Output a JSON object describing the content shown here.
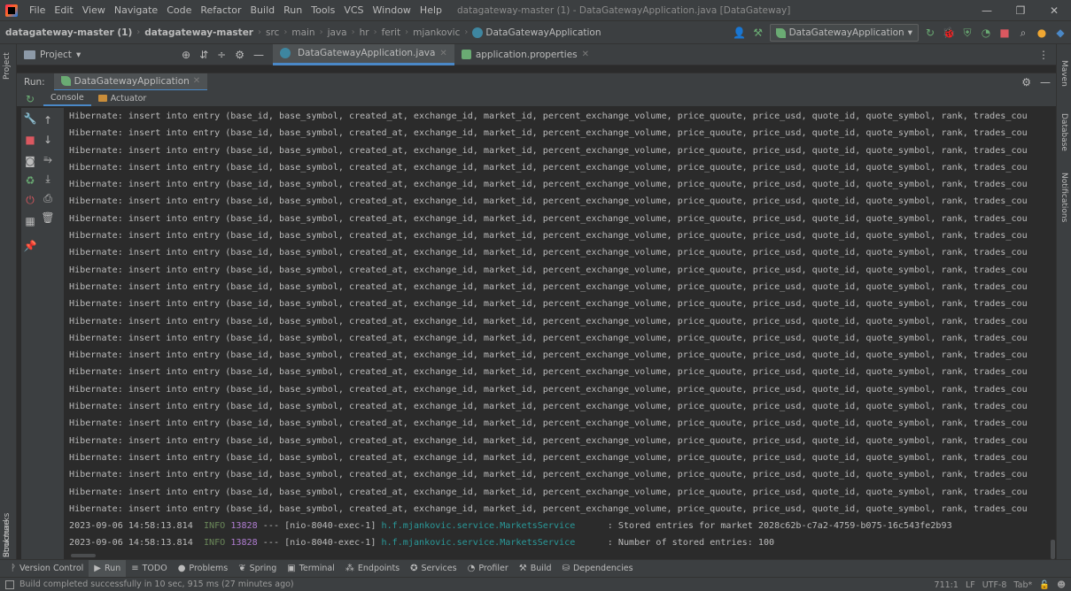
{
  "window": {
    "menu": [
      "File",
      "Edit",
      "View",
      "Navigate",
      "Code",
      "Refactor",
      "Build",
      "Run",
      "Tools",
      "VCS",
      "Window",
      "Help"
    ],
    "title": "datagateway-master (1) - DataGatewayApplication.java [DataGateway]",
    "controls": [
      "—",
      "❐",
      "✕"
    ]
  },
  "navbar": {
    "crumbs": [
      "datagateway-master (1)",
      "datagateway-master",
      "src",
      "main",
      "java",
      "hr",
      "ferit",
      "mjankovic",
      "DataGatewayApplication"
    ],
    "run_config": "DataGatewayApplication"
  },
  "project_bar": {
    "project_label": "Project",
    "tabs": [
      {
        "label": "DataGatewayApplication.java",
        "active": true
      },
      {
        "label": "application.properties",
        "active": false
      }
    ]
  },
  "left_stripe": [
    "Project",
    "Bookmarks",
    "Structure"
  ],
  "right_stripe": [
    "Maven",
    "Database",
    "Notifications"
  ],
  "run_window": {
    "label": "Run:",
    "tab": "DataGatewayApplication",
    "subtabs": [
      "Console",
      "Actuator"
    ]
  },
  "console": {
    "insert_line": "Hibernate: insert into entry (base_id, base_symbol, created_at, exchange_id, market_id, percent_exchange_volume, price_quoute, price_usd, quote_id, quote_symbol, rank, trades_cou",
    "insert_count": 24,
    "log_lines": [
      {
        "time": "2023-09-06 14:58:13.814",
        "level": "INFO",
        "pid": "13828",
        "thread": " --- [nio-8040-exec-1] ",
        "logger": "h.f.mjankovic.service.MarketsService",
        "message": "      : Stored entries for market 2028c62b-c7a2-4759-b075-16c543fe2b93"
      },
      {
        "time": "2023-09-06 14:58:13.814",
        "level": "INFO",
        "pid": "13828",
        "thread": " --- [nio-8040-exec-1] ",
        "logger": "h.f.mjankovic.service.MarketsService",
        "message": "      : Number of stored entries: 100"
      }
    ]
  },
  "bottom_tools": [
    {
      "glyph": "ᚹ",
      "label": "Version Control",
      "active": false
    },
    {
      "glyph": "▶",
      "label": "Run",
      "active": true
    },
    {
      "glyph": "≡",
      "label": "TODO",
      "active": false
    },
    {
      "glyph": "●",
      "label": "Problems",
      "active": false
    },
    {
      "glyph": "❦",
      "label": "Spring",
      "active": false
    },
    {
      "glyph": "▣",
      "label": "Terminal",
      "active": false
    },
    {
      "glyph": "⁂",
      "label": "Endpoints",
      "active": false
    },
    {
      "glyph": "✪",
      "label": "Services",
      "active": false
    },
    {
      "glyph": "◔",
      "label": "Profiler",
      "active": false
    },
    {
      "glyph": "⚒",
      "label": "Build",
      "active": false
    },
    {
      "glyph": "⛁",
      "label": "Dependencies",
      "active": false
    }
  ],
  "statusbar": {
    "message": "Build completed successfully in 10 sec, 915 ms (27 minutes ago)",
    "right": [
      "711:1",
      "LF",
      "UTF-8",
      "Tab*"
    ]
  }
}
